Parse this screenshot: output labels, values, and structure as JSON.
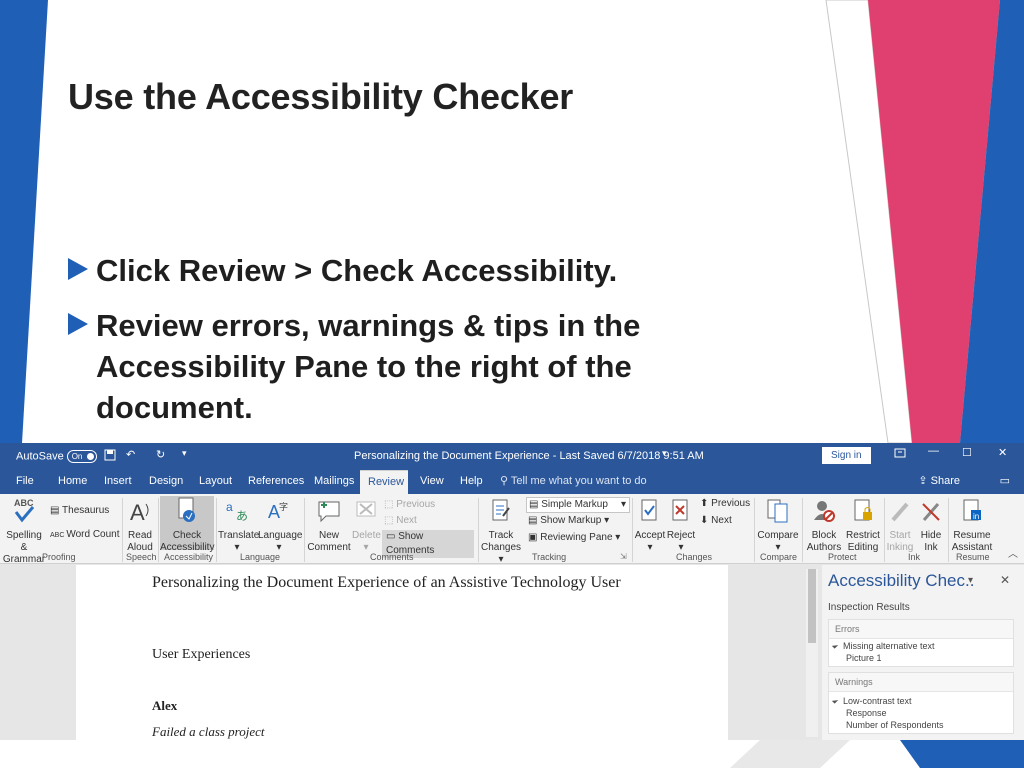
{
  "slide": {
    "title": "Use the Accessibility Checker",
    "bullets": [
      "Click Review > Check Accessibility.",
      "Review errors, warnings & tips in the Accessibility Pane to the right of the document."
    ],
    "colors": {
      "accent_blue": "#1f5fb5",
      "accent_pink": "#e04070",
      "accent_tan": "#d9dcc2",
      "word_blue": "#2b579a"
    }
  },
  "word": {
    "titlebar": {
      "autosave_label": "AutoSave",
      "autosave_state": "On",
      "doc_title": "Personalizing the Document Experience  -  Last Saved 6/7/2018 9:51 AM",
      "sign_in": "Sign in",
      "icons": [
        "save-icon",
        "undo-icon",
        "redo-icon",
        "customize-icon",
        "ribbon-options-icon",
        "minimize-icon",
        "restore-icon",
        "close-icon"
      ]
    },
    "tabs": [
      "File",
      "Home",
      "Insert",
      "Design",
      "Layout",
      "References",
      "Mailings",
      "Review",
      "View",
      "Help"
    ],
    "active_tab": "Review",
    "tell_me": "Tell me what you want to do",
    "share": "Share",
    "ribbon": {
      "proofing": {
        "spelling": [
          "Spelling &",
          "Grammar"
        ],
        "thesaurus": "Thesaurus",
        "word_count": "Word Count",
        "abc": "ABC",
        "label": "Proofing"
      },
      "speech": {
        "read_aloud": [
          "Read",
          "Aloud"
        ],
        "label": "Speech"
      },
      "accessibility": {
        "check": [
          "Check",
          "Accessibility"
        ],
        "label": "Accessibility"
      },
      "language": {
        "translate": "Translate",
        "language": "Language",
        "label": "Language"
      },
      "comments": {
        "new_comment": [
          "New",
          "Comment"
        ],
        "delete": "Delete",
        "previous": "Previous",
        "next": "Next",
        "show_comments": "Show Comments",
        "label": "Comments"
      },
      "tracking": {
        "track_changes": [
          "Track",
          "Changes"
        ],
        "markup_select": "Simple Markup",
        "show_markup": "Show Markup",
        "reviewing_pane": "Reviewing Pane",
        "label": "Tracking"
      },
      "changes": {
        "accept": "Accept",
        "reject": "Reject",
        "previous": "Previous",
        "next": "Next",
        "label": "Changes"
      },
      "compare": {
        "compare": "Compare",
        "label": "Compare"
      },
      "protect": {
        "block_authors": [
          "Block",
          "Authors"
        ],
        "restrict_editing": [
          "Restrict",
          "Editing"
        ],
        "label": "Protect"
      },
      "ink": {
        "start_inking": [
          "Start",
          "Inking"
        ],
        "hide_ink": [
          "Hide",
          "Ink"
        ],
        "label": "Ink"
      },
      "resume": {
        "resume_assistant": [
          "Resume",
          "Assistant"
        ],
        "label": "Resume"
      }
    },
    "document": {
      "heading": "Personalizing the Document Experience of an Assistive Technology User",
      "section": "User Experiences",
      "name": "Alex",
      "note": "Failed a class project"
    },
    "pane": {
      "title": "Accessibility Chec..",
      "subtitle": "Inspection Results",
      "errors_header": "Errors",
      "errors": [
        {
          "issue": "Missing alternative text",
          "item": "Picture 1"
        }
      ],
      "warnings_header": "Warnings",
      "warnings": [
        {
          "issue": "Low-contrast text",
          "items": [
            "Response",
            "Number of Respondents"
          ]
        }
      ]
    }
  }
}
